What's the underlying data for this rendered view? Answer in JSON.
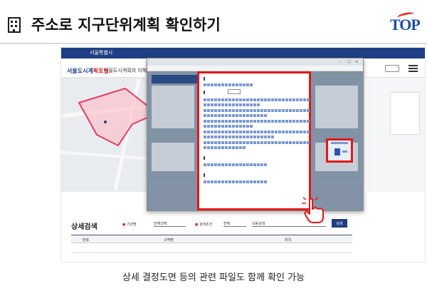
{
  "slide": {
    "title": "주소로 지구단위계획 확인하기",
    "logo_text": "TOP",
    "caption": "상세 결정도면 등의 관련 파일도 함께 확인 가능",
    "icon": "building-icon",
    "highlight_color": "#e01818",
    "brand_color": "#1e3f84"
  },
  "site": {
    "topbar": {
      "seoul": "서울특별시",
      "notice": "",
      "links": ""
    },
    "brand_small": "",
    "brand_main": "서울도시계",
    "brand_accent": "획포털",
    "nav": "서울도시계획의 이해",
    "map_service": ""
  },
  "popup": {
    "chrome_title": "",
    "url": "",
    "header": "",
    "sec1": "",
    "sec2": "",
    "sec2_select": "",
    "sec3": "",
    "sec4": ""
  },
  "notes": {
    "label": "",
    "text": ""
  },
  "search": {
    "title": "상세검색",
    "agency_label": "기관명",
    "agency_value": "전체선택",
    "condition_label": "검색조건",
    "condition_value": "전체",
    "keyword": "내용검색",
    "button": "검색",
    "columns": [
      "번호",
      "구역명",
      "위치"
    ],
    "row": {
      "no": "",
      "name": "",
      "loc": ""
    }
  }
}
